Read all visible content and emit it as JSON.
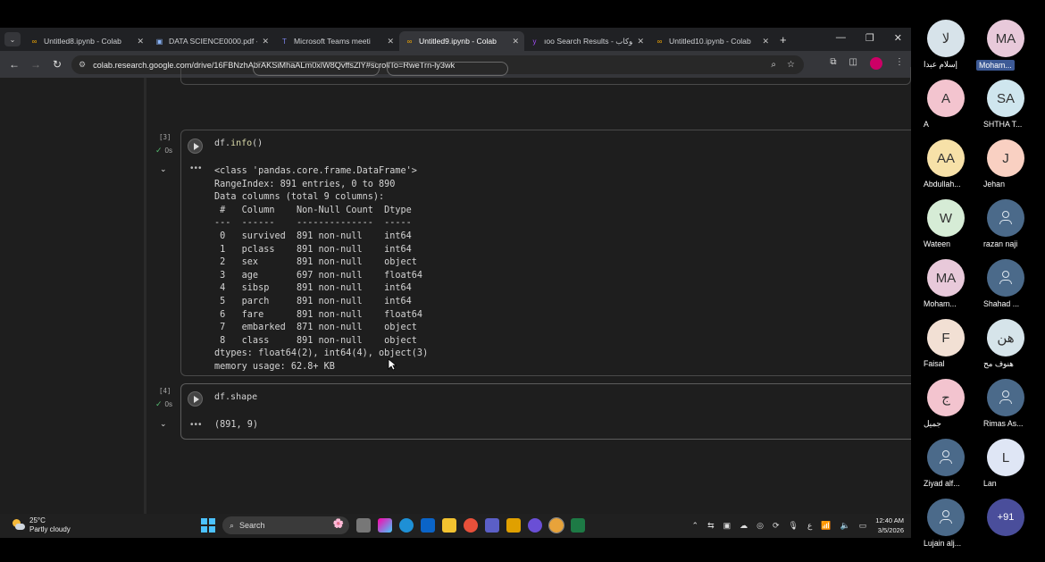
{
  "browser": {
    "tabs": [
      {
        "label": "Untitled8.ipynb - Colab",
        "icon": "colab-icon",
        "active": false
      },
      {
        "label": "DATA SCIENCE0000.pdf - C",
        "icon": "pdf-icon",
        "active": false
      },
      {
        "label": "Microsoft Teams meeti",
        "icon": "teams-icon",
        "active": false
      },
      {
        "label": "Untitled9.ipynb - Colab",
        "icon": "colab-icon",
        "active": true
      },
      {
        "label": "ıoo Search Results - كوكاب",
        "icon": "yahoo-icon",
        "active": false
      },
      {
        "label": "Untitled10.ipynb - Colab",
        "icon": "colab-icon",
        "active": false
      }
    ],
    "url": "colab.research.google.com/drive/16FBNzhAbrAKSiMhaALm0xlW8QvffsZlY#scrollTo=RweTrn-ly3wk"
  },
  "notebook": {
    "cell3": {
      "exec_count": "[3]",
      "exec_time": "0s",
      "code_obj": "df.",
      "code_fn": "info",
      "code_args": "()",
      "output": "<class 'pandas.core.frame.DataFrame'>\nRangeIndex: 891 entries, 0 to 890\nData columns (total 9 columns):\n #   Column    Non-Null Count  Dtype  \n---  ------    --------------  -----  \n 0   survived  891 non-null    int64  \n 1   pclass    891 non-null    int64  \n 2   sex       891 non-null    object \n 3   age       697 non-null    float64\n 4   sibsp     891 non-null    int64  \n 5   parch     891 non-null    int64  \n 6   fare      891 non-null    float64\n 7   embarked  871 non-null    object \n 8   class     891 non-null    object \ndtypes: float64(2), int64(4), object(3)\nmemory usage: 62.8+ KB"
    },
    "cell4": {
      "exec_count": "[4]",
      "exec_time": "0s",
      "code": "df.shape",
      "output": "(891, 9)"
    }
  },
  "taskbar": {
    "weather_temp": "25°C",
    "weather_desc": "Partly cloudy",
    "search_placeholder": "Search",
    "time": "12:40 AM",
    "date": "3/5/2026",
    "lang": "ع"
  },
  "participants": [
    {
      "initials": "لا",
      "name": "إسلام عبدا",
      "color": "#d7e3ea"
    },
    {
      "initials": "MA",
      "name": "Moham...",
      "color": "#e8c9da",
      "highlight": true
    },
    {
      "initials": "A",
      "name": "A",
      "color": "#f3c4cf"
    },
    {
      "initials": "SA",
      "name": "SHTHA T...",
      "color": "#cfe6ee"
    },
    {
      "initials": "AA",
      "name": "Abdullah...",
      "color": "#f7e1a8"
    },
    {
      "initials": "J",
      "name": "Jehan",
      "color": "#f9d0c2"
    },
    {
      "initials": "W",
      "name": "Wateen",
      "color": "#d6ecd6"
    },
    {
      "initials": "",
      "name": "razan naji",
      "color": "#4b6a8a"
    },
    {
      "initials": "MA",
      "name": "Moham...",
      "color": "#e8c9da"
    },
    {
      "initials": "",
      "name": "Shahad ...",
      "color": "#4b6a8a"
    },
    {
      "initials": "F",
      "name": "Faisal",
      "color": "#f2e0d4"
    },
    {
      "initials": "هن",
      "name": "هنوف مح",
      "color": "#d6e4ea"
    },
    {
      "initials": "ج",
      "name": "جميل",
      "color": "#f3c4cf"
    },
    {
      "initials": "",
      "name": "Rimas As...",
      "color": "#4b6a8a"
    },
    {
      "initials": "",
      "name": "Ziyad alf...",
      "color": "#4b6a8a"
    },
    {
      "initials": "L",
      "name": "Lan",
      "color": "#dfe6f5"
    },
    {
      "initials": "",
      "name": "Lujain alj...",
      "color": "#4b6a8a"
    },
    {
      "initials": "+91",
      "name": "",
      "color": "#4a4e9b"
    }
  ]
}
